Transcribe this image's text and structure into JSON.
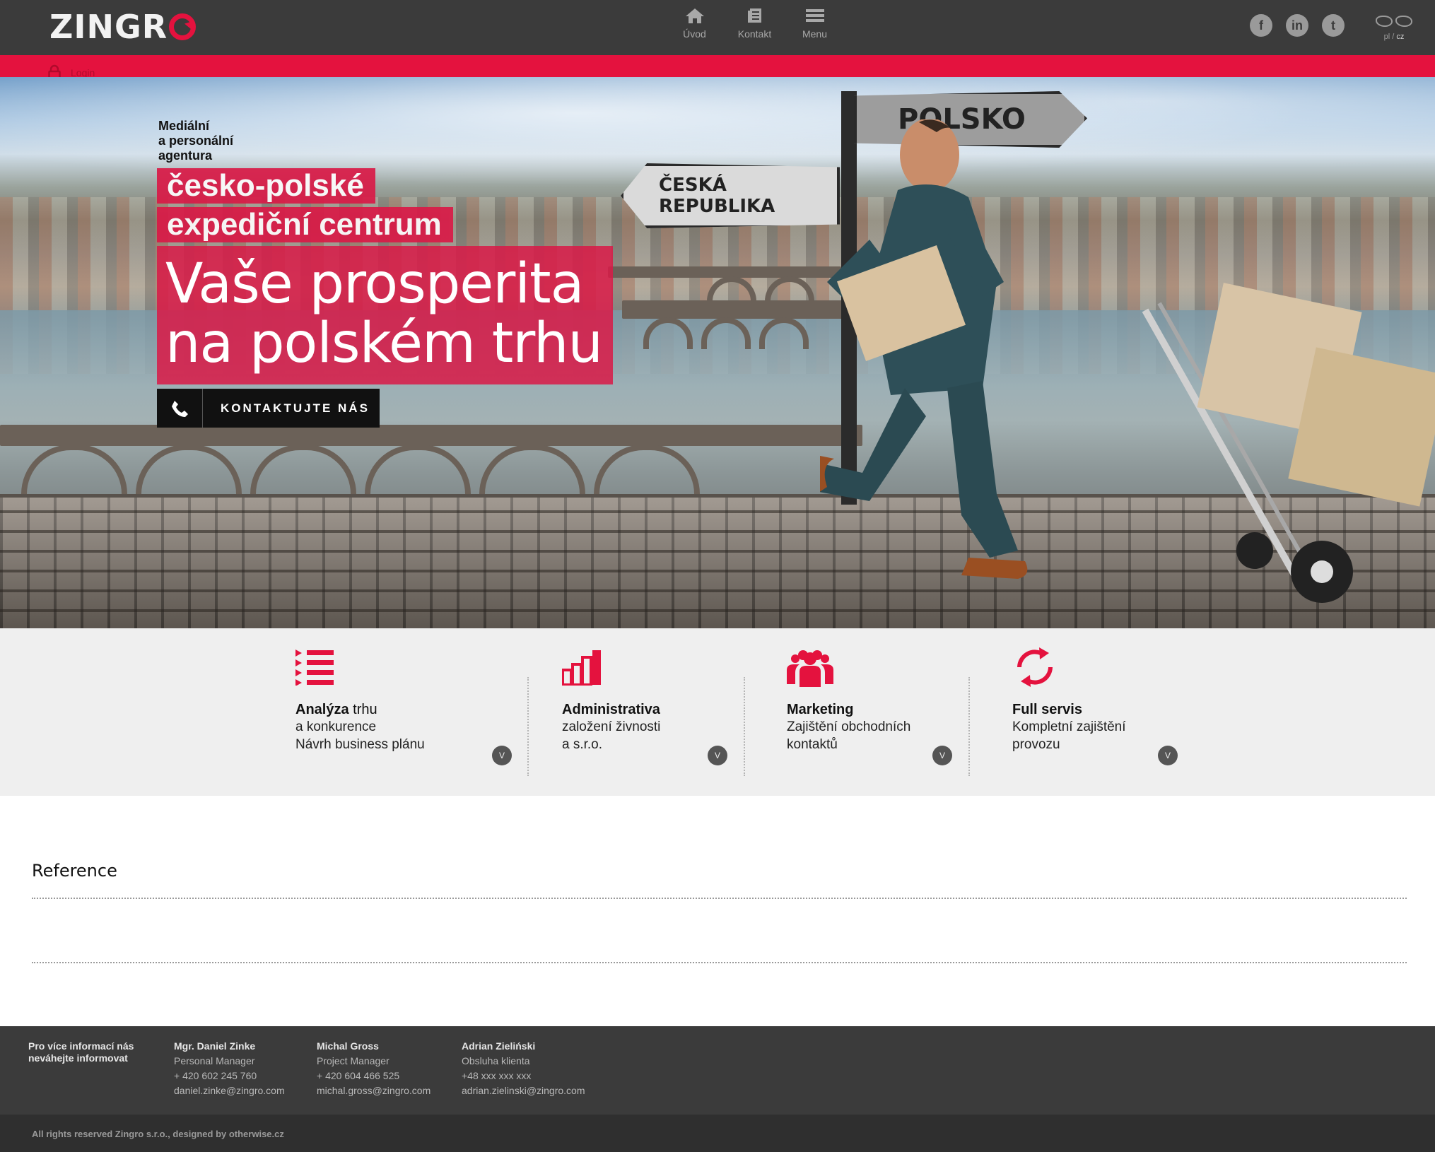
{
  "header": {
    "logo_text": "ZINGR",
    "nav": [
      {
        "label": "Úvod",
        "icon": "home-icon"
      },
      {
        "label": "Kontakt",
        "icon": "document-icon"
      },
      {
        "label": "Menu",
        "icon": "hamburger-icon"
      }
    ],
    "social": [
      {
        "label": "f",
        "icon": "facebook-icon"
      },
      {
        "label": "in",
        "icon": "linkedin-icon"
      },
      {
        "label": "t",
        "icon": "twitter-icon"
      }
    ],
    "lang": {
      "pl": "pl",
      "sep": "/",
      "cz": "cz"
    },
    "login_label": "Login"
  },
  "hero": {
    "tagline": "Mediální\na personální\nagentura",
    "headline_1": "česko-polské",
    "headline_2": "expediční centrum",
    "big_line_1": "Vaše prosperita",
    "big_line_2": "na polském trhu",
    "cta_label": "KONTAKTUJTE NÁS",
    "sign_polsko": "POLSKO",
    "sign_cz": "ČESKÁ REPUBLIKA"
  },
  "services": [
    {
      "title_bold": "Analýza",
      "title_rest": " trhu",
      "line_1": "a konkurence",
      "line_2": "Návrh business plánu",
      "icon": "list-icon"
    },
    {
      "title_bold": "Administrativa",
      "title_rest": "",
      "line_1": "založení živnosti",
      "line_2": "a s.r.o.",
      "icon": "bar-chart-icon"
    },
    {
      "title_bold": "Marketing",
      "title_rest": "",
      "line_1": "Zajištění obchodních",
      "line_2": "kontaktů",
      "icon": "people-icon"
    },
    {
      "title_bold": "Full servis",
      "title_rest": "",
      "line_1": "Kompletní zajištění",
      "line_2": "provozu",
      "icon": "refresh-icon"
    }
  ],
  "more_glyph": "V",
  "reference": {
    "title": "Reference"
  },
  "footer": {
    "intro_1": "Pro více informací nás",
    "intro_2": "neváhejte informovat",
    "contacts": [
      {
        "name": "Mgr. Daniel Zinke",
        "role": "Personal Manager",
        "phone": "+ 420 602 245 760",
        "email": "daniel.zinke@zingro.com"
      },
      {
        "name": "Michal Gross",
        "role": "Project Manager",
        "phone": "+ 420 604 466 525",
        "email": "michal.gross@zingro.com"
      },
      {
        "name": "Adrian Zieliński",
        "role": "Obsluha klienta",
        "phone": "+48 xxx xxx xxx",
        "email": "adrian.zielinski@zingro.com"
      }
    ],
    "copyright": "All rights reserved Zingro s.r.o., designed by otherwise.cz"
  },
  "colors": {
    "accent": "#e4123e",
    "dark": "#3b3b3b",
    "panel": "#efefef"
  }
}
